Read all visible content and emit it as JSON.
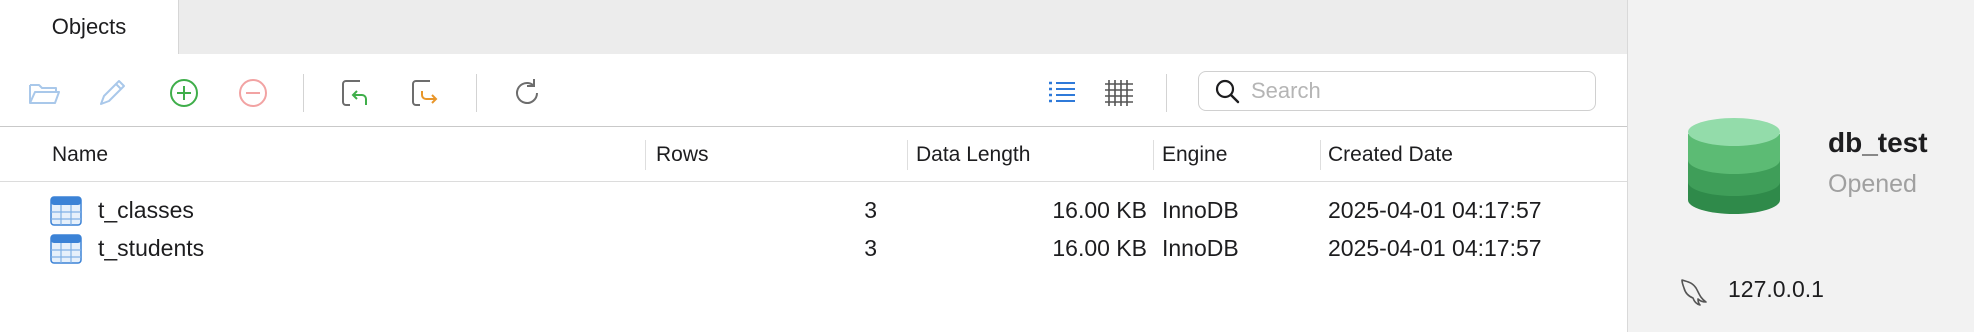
{
  "tabs": [
    {
      "label": "Objects"
    }
  ],
  "toolbar": {
    "buttons": [
      {
        "name": "open-table",
        "icon": "folder-open-icon"
      },
      {
        "name": "design-table",
        "icon": "pencil-icon"
      },
      {
        "name": "new-table",
        "icon": "plus-circle-icon"
      },
      {
        "name": "delete-table",
        "icon": "minus-circle-icon"
      },
      {
        "name": "import-wizard",
        "icon": "import-icon"
      },
      {
        "name": "export-wizard",
        "icon": "export-icon"
      },
      {
        "name": "refresh",
        "icon": "refresh-icon"
      },
      {
        "name": "list-view",
        "icon": "list-view-icon"
      },
      {
        "name": "grid-view",
        "icon": "grid-view-icon"
      }
    ],
    "search": {
      "placeholder": "Search",
      "value": ""
    }
  },
  "table": {
    "columns": [
      "Name",
      "Rows",
      "Data Length",
      "Engine",
      "Created Date"
    ],
    "rows": [
      {
        "name": "t_classes",
        "rows": "3",
        "data_length": "16.00 KB",
        "engine": "InnoDB",
        "created": "2025-04-01 04:17:57"
      },
      {
        "name": "t_students",
        "rows": "3",
        "data_length": "16.00 KB",
        "engine": "InnoDB",
        "created": "2025-04-01 04:17:57"
      }
    ]
  },
  "side_panel": {
    "db_name": "db_test",
    "status": "Opened",
    "host": "127.0.0.1"
  },
  "colors": {
    "green_accent": "#3fae4a",
    "red_disabled": "#f2a3a3",
    "blue_active": "#2f7ad9",
    "db_green": "#4fb36b"
  }
}
